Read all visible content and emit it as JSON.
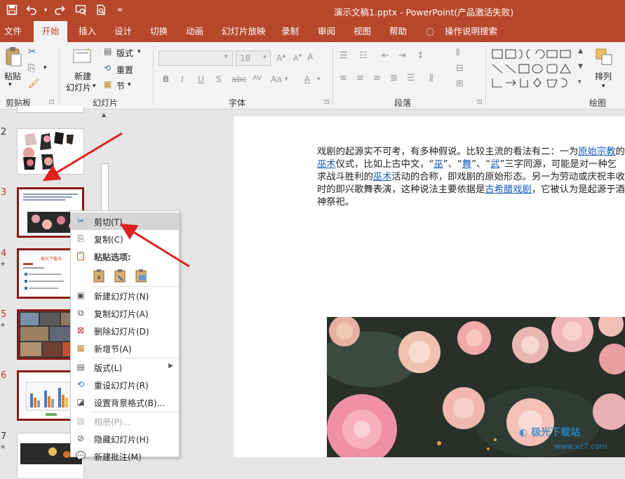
{
  "window": {
    "title": "演示文稿1.pptx  -  PowerPoint(产品激活失败)"
  },
  "quick_access": [
    {
      "name": "save-icon",
      "glyph": "🖫"
    },
    {
      "name": "undo-icon",
      "glyph": "↶"
    },
    {
      "name": "redo-icon",
      "glyph": "↷"
    },
    {
      "name": "slideshow-start-icon",
      "glyph": "▶"
    },
    {
      "name": "print-preview-icon",
      "glyph": "🗋"
    },
    {
      "name": "customize-qat-icon",
      "glyph": "▾"
    }
  ],
  "tabs": [
    "文件",
    "开始",
    "插入",
    "设计",
    "切换",
    "动画",
    "幻灯片放映",
    "录制",
    "审阅",
    "视图",
    "帮助",
    "操作说明搜索"
  ],
  "ribbon": {
    "clipboard": {
      "paste": "粘贴",
      "group": "剪贴板"
    },
    "slides": {
      "new_slide_1": "新建",
      "new_slide_2": "幻灯片",
      "layout": "版式",
      "reset": "重置",
      "section": "节",
      "group": "幻灯片"
    },
    "font": {
      "font_size": "18",
      "bold": "B",
      "italic": "I",
      "underline": "U",
      "strike": "S",
      "spacing": "AV",
      "case": "Aa",
      "color": "A",
      "group": "字体"
    },
    "paragraph": {
      "group": "段落"
    },
    "drawing": {
      "arrange": "排列",
      "group": "绘图"
    }
  },
  "slides": [
    {
      "num": "2",
      "star": false,
      "selected": false
    },
    {
      "num": "3",
      "star": false,
      "selected": true
    },
    {
      "num": "4",
      "star": true,
      "selected": true
    },
    {
      "num": "5",
      "star": true,
      "selected": true
    },
    {
      "num": "6",
      "star": false,
      "selected": true
    },
    {
      "num": "7",
      "star": true,
      "selected": false
    }
  ],
  "thumb4_title": "极光下载站",
  "context_menu": {
    "cut": "剪切(T)",
    "copy": "复制(C)",
    "paste_options": "粘贴选项:",
    "new_slide": "新建幻灯片(N)",
    "duplicate_slide": "复制幻灯片(A)",
    "delete_slide": "删除幻灯片(D)",
    "add_section": "新增节(A)",
    "layout": "版式(L)",
    "reset_slide": "重设幻灯片(R)",
    "format_background": "设置背景格式(B)...",
    "photo_album": "相册(P)...",
    "hide_slide": "隐藏幻灯片(H)",
    "new_comment": "新建批注(M)"
  },
  "slide_text": {
    "p1": "戏剧的起源实不可考，有多种假说。比较主流的看法有二：一为",
    "link1": "原始宗教",
    "p2": "的",
    "link2": "巫术",
    "p3": "仪式，比如上古中文，“",
    "link3": "巫",
    "p4": "”、“",
    "link4": "舞",
    "p5": "”、“",
    "link5": "武",
    "p6": "”三字同源，可能是对一种乞求战斗胜利的",
    "link6": "巫术",
    "p7": "活动的合称，即戏剧的原始形态。另一为劳动或庆祝丰收时的即兴歌舞表演，这种说法主要依据是",
    "link7": "古希腊戏剧",
    "p8": "，它被认为是起源于酒神祭祀。"
  },
  "watermark": {
    "name": "极光下载站",
    "url": "www.xz7.com"
  },
  "colors": {
    "accent": "#b7472a",
    "link": "#1a5cb8",
    "selection_border": "#8b1a1a",
    "arrow": "#e02020"
  }
}
